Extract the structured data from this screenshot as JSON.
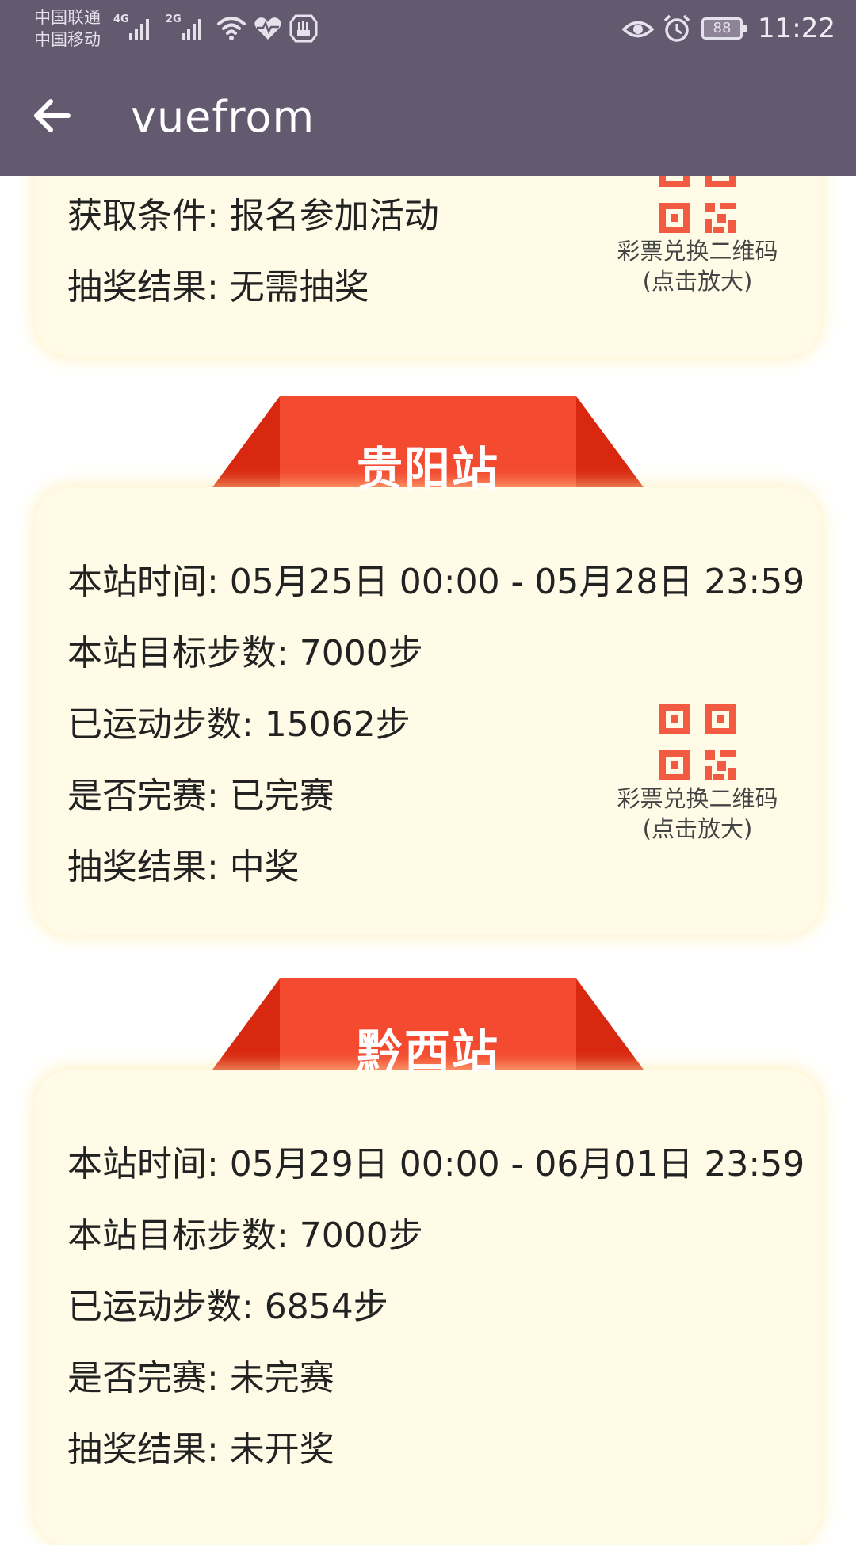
{
  "status_bar": {
    "carrier_1": "中国联通",
    "carrier_2": "中国移动",
    "network_1": "4G",
    "network_2": "2G",
    "battery": "88",
    "time": "11:22",
    "icons": [
      "wifi-icon",
      "heart-icon",
      "hand-icon",
      "eye-icon",
      "alarm-icon",
      "battery-icon"
    ]
  },
  "header": {
    "title": "vuefrom",
    "back_icon": "arrow-left-icon"
  },
  "qr": {
    "caption_line1": "彩票兑换二维码",
    "caption_line2": "(点击放大)"
  },
  "cards": [
    {
      "station": "",
      "rows": [
        "获取条件: 报名参加活动",
        "抽奖结果: 无需抽奖"
      ]
    },
    {
      "station": "贵阳站",
      "rows": [
        "本站时间: 05月25日 00:00 - 05月28日 23:59",
        "本站目标步数: 7000步",
        "已运动步数: 15062步",
        "是否完赛: 已完赛",
        "抽奖结果: 中奖"
      ]
    },
    {
      "station": "黔西站",
      "rows": [
        "本站时间: 05月29日 00:00 - 06月01日 23:59",
        "本站目标步数: 7000步",
        "已运动步数: 6854步",
        "是否完赛: 未完赛",
        "抽奖结果: 未开奖"
      ]
    }
  ],
  "colors": {
    "header_bg": "#645a70",
    "card_bg": "#fffbe6",
    "ribbon_red": "#f44a30",
    "ribbon_dark_red": "#d92810",
    "qr_red": "#f25a42"
  }
}
